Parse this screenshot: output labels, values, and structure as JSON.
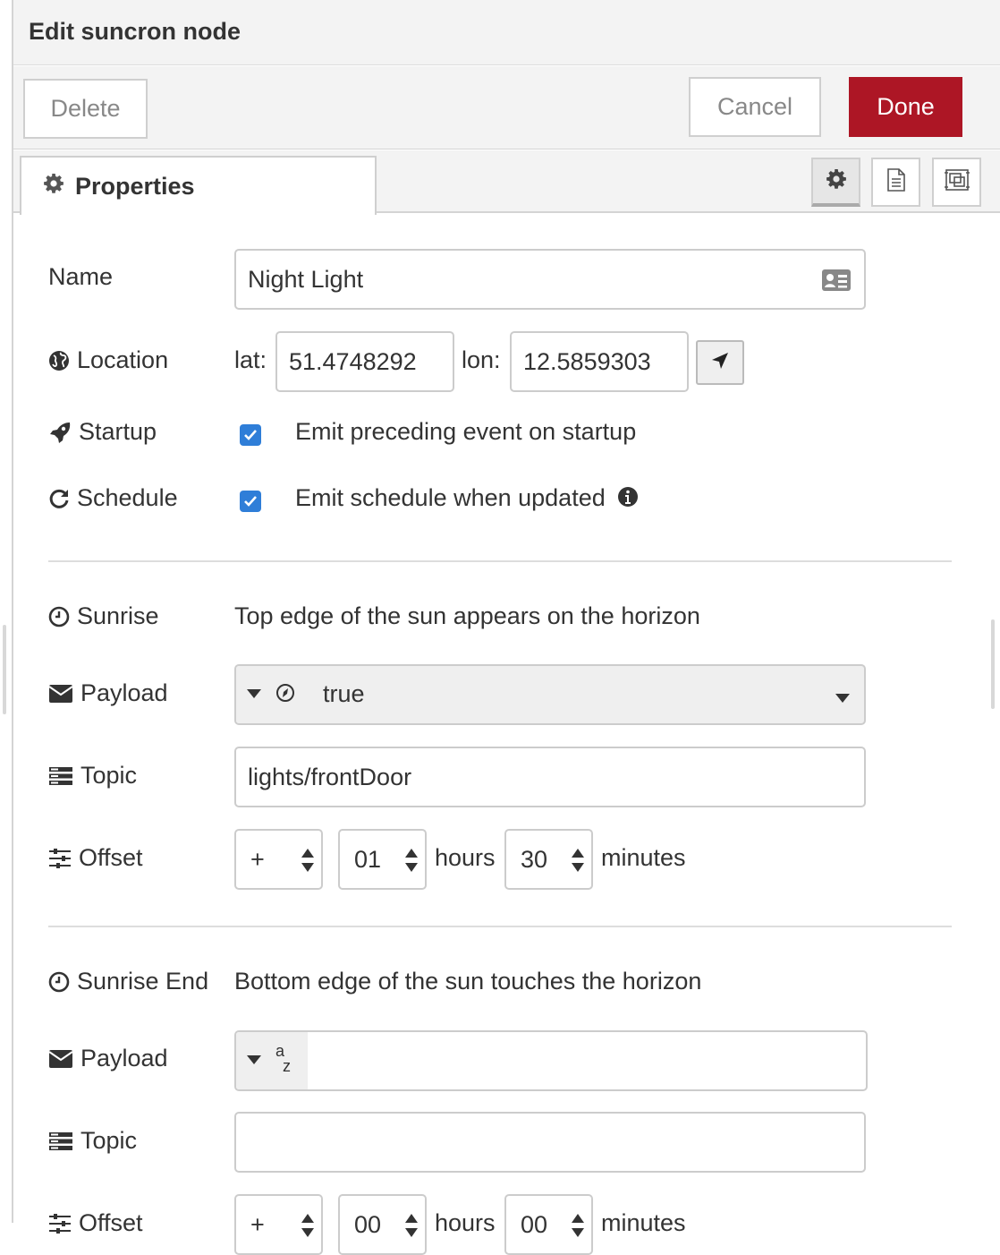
{
  "header": {
    "title": "Edit suncron node"
  },
  "toolbar": {
    "delete_label": "Delete",
    "cancel_label": "Cancel",
    "done_label": "Done"
  },
  "tabs": {
    "properties_label": "Properties"
  },
  "form": {
    "name": {
      "label": "Name",
      "value": "Night Light"
    },
    "location": {
      "label": "Location",
      "lat_label": "lat:",
      "lat_value": "51.4748292",
      "lon_label": "lon:",
      "lon_value": "12.5859303"
    },
    "startup": {
      "label": "Startup",
      "checkbox_text": "Emit preceding event on startup",
      "checked": true
    },
    "schedule": {
      "label": "Schedule",
      "checkbox_text": "Emit schedule when updated",
      "checked": true
    }
  },
  "events": [
    {
      "label": "Sunrise",
      "description": "Top edge of the sun appears on the horizon",
      "payload_label": "Payload",
      "payload_type": "boolean",
      "payload_value": "true",
      "topic_label": "Topic",
      "topic_value": "lights/frontDoor",
      "offset_label": "Offset",
      "offset_sign": "+",
      "offset_hours": "01",
      "hours_label": "hours",
      "offset_minutes": "30",
      "minutes_label": "minutes"
    },
    {
      "label": "Sunrise End",
      "description": "Bottom edge of the sun touches the horizon",
      "payload_label": "Payload",
      "payload_type": "string",
      "payload_value": "",
      "topic_label": "Topic",
      "topic_value": "",
      "offset_label": "Offset",
      "offset_sign": "+",
      "offset_hours": "00",
      "hours_label": "hours",
      "offset_minutes": "00",
      "minutes_label": "minutes"
    }
  ],
  "colors": {
    "done_bg": "#ad1625",
    "checkbox": "#2f7ed8",
    "header_bg": "#f3f3f3"
  }
}
